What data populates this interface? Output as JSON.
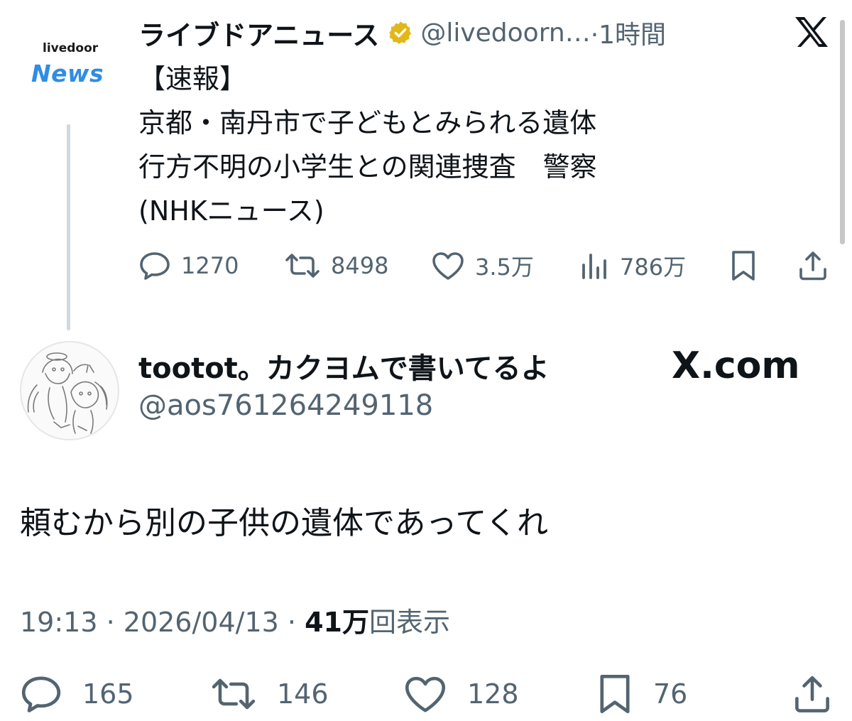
{
  "quoted_tweet": {
    "avatar": {
      "brand_top": "livedoor",
      "brand_bottom": "News"
    },
    "name": "ライブドアニュース",
    "handle": "@livedoorn…",
    "time": "·1時間",
    "lines": [
      "【速報】",
      "京都・南丹市で子どもとみられる遺体",
      "行方不明の小学生との関連捜査　警察",
      "(NHKニュース)"
    ],
    "actions": {
      "replies": "1270",
      "reposts": "8498",
      "likes": "3.5万",
      "views": "786万"
    }
  },
  "user": {
    "name": "tootot。カクヨムで書いてるよ",
    "handle": "@aos761264249118",
    "watermark": "X.com"
  },
  "tweet": {
    "text": "頼むから別の子供の遺体であってくれ",
    "time": "19:13",
    "date": "2026/04/13",
    "views_count": "41万",
    "views_label": "回表示",
    "actions": {
      "replies": "165",
      "reposts": "146",
      "likes": "128",
      "bookmarks": "76"
    }
  },
  "icons": [
    "verified-badge-icon",
    "x-logo-icon",
    "reply-icon",
    "repost-icon",
    "like-icon",
    "views-icon",
    "bookmark-icon",
    "share-icon"
  ],
  "colors": {
    "muted": "#536471",
    "verified": "#e2b719",
    "brand_news": "#2f8de4",
    "text": "#0f1419"
  }
}
